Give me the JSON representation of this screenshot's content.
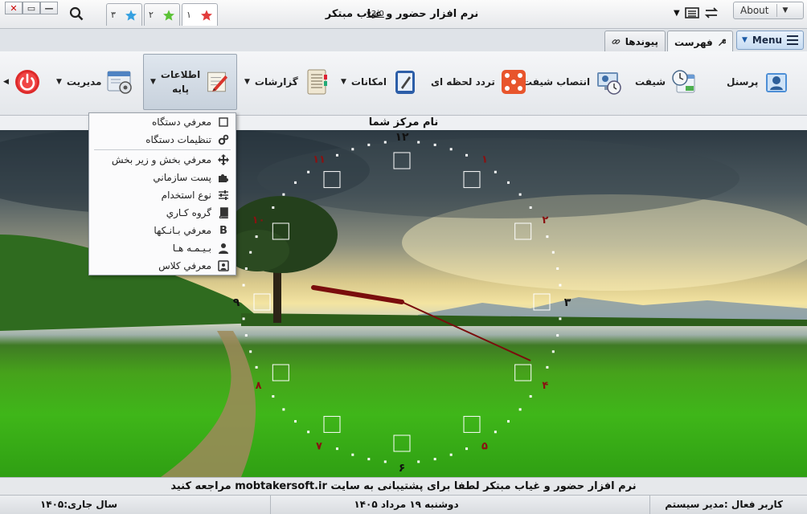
{
  "titlebar": {
    "window_buttons": {
      "close": "✕",
      "minimize": "—",
      "maximize": "▭"
    },
    "fav_tabs": [
      {
        "num": "۱",
        "color": "#e23b3b"
      },
      {
        "num": "۲",
        "color": "#5bc236"
      },
      {
        "num": "۳",
        "color": "#35a0e0"
      }
    ],
    "app_title": "نرم افزار حضور و غیاب مبتکر",
    "version": "v3.0",
    "about_label": "About"
  },
  "tabs": {
    "links_label": "پیوندها",
    "list_label": "فهرست",
    "menu_label": "Menu"
  },
  "ribbon": {
    "personnel": "پرسنل",
    "shift": "شیفت",
    "shift_assign": "انتصاب شیفت",
    "attendance": "تردد لحظه ای",
    "facilities": "امکانات",
    "reports": "گزارشات",
    "base_info_line1": "اطلاعات",
    "base_info_line2": "پایه",
    "management": "مدیریت"
  },
  "center_name": "نام مرکز شما",
  "dropdown": {
    "items": [
      {
        "label": "معرفي دستگاه",
        "icon": "device-icon"
      },
      {
        "label": "تنظيمات دستگاه",
        "icon": "gears-icon"
      },
      {
        "label": "معرفي بخش و زير بخش",
        "icon": "move-arrows-icon"
      },
      {
        "label": "پست سازماني",
        "icon": "puzzle-icon"
      },
      {
        "label": "نوع استخدام",
        "icon": "sliders-icon"
      },
      {
        "label": "گروه كـاري",
        "icon": "book-icon"
      },
      {
        "label": "معرفي بـانـكها",
        "icon": "bitcoin-icon"
      },
      {
        "label": "بـيـمـه هـا",
        "icon": "people-icon"
      },
      {
        "label": "معرفي كلاس",
        "icon": "badge-icon"
      }
    ]
  },
  "clock": {
    "numerals": [
      "۱۲",
      "۱",
      "۲",
      "۳",
      "۴",
      "۵",
      "۶",
      "۷",
      "۸",
      "۹",
      "۱۰",
      "۱۱"
    ],
    "hour_color": "#7a0d0d"
  },
  "footer": {
    "message": "نرم افزار حضور و غیاب مبتکر لطفا برای پشتیبانی به سایت mobtakersoft.ir مراجعه کنید",
    "active_user": "کاربر فعال :مدیر سیستم",
    "date": "دوشنبه ۱۹ مرداد ۱۴۰۵",
    "current_year": "سال جاری:۱۴۰۵"
  }
}
